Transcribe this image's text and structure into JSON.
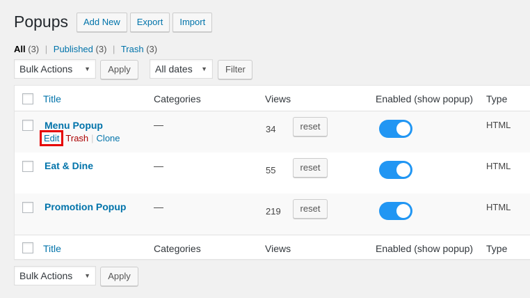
{
  "header": {
    "title": "Popups",
    "buttons": {
      "add_new": "Add New",
      "export": "Export",
      "import": "Import"
    }
  },
  "filters": {
    "all": "All",
    "all_count": "(3)",
    "published": "Published",
    "published_count": "(3)",
    "trash": "Trash",
    "trash_count": "(3)",
    "separator": "|"
  },
  "top_controls": {
    "bulk_actions": "Bulk Actions",
    "apply": "Apply",
    "dates": "All dates",
    "filter": "Filter"
  },
  "table": {
    "columns": {
      "title": "Title",
      "categories": "Categories",
      "views": "Views",
      "enabled": "Enabled (show popup)",
      "type": "Type"
    },
    "rows": [
      {
        "title": "Menu Popup",
        "categories": "—",
        "views": "34",
        "reset": "reset",
        "enabled": true,
        "type": "HTML"
      },
      {
        "title": "Eat & Dine",
        "categories": "—",
        "views": "55",
        "reset": "reset",
        "enabled": true,
        "type": "HTML"
      },
      {
        "title": "Promotion Popup",
        "categories": "—",
        "views": "219",
        "reset": "reset",
        "enabled": true,
        "type": "HTML"
      }
    ],
    "row_actions": {
      "edit": "Edit",
      "trash": "Trash",
      "clone": "Clone",
      "separator": "|"
    }
  },
  "bottom_controls": {
    "bulk_actions": "Bulk Actions",
    "apply": "Apply"
  },
  "colors": {
    "link": "#0073aa",
    "toggle_on": "#2196f3",
    "trash": "#aa0000",
    "highlight": "#e60000"
  }
}
